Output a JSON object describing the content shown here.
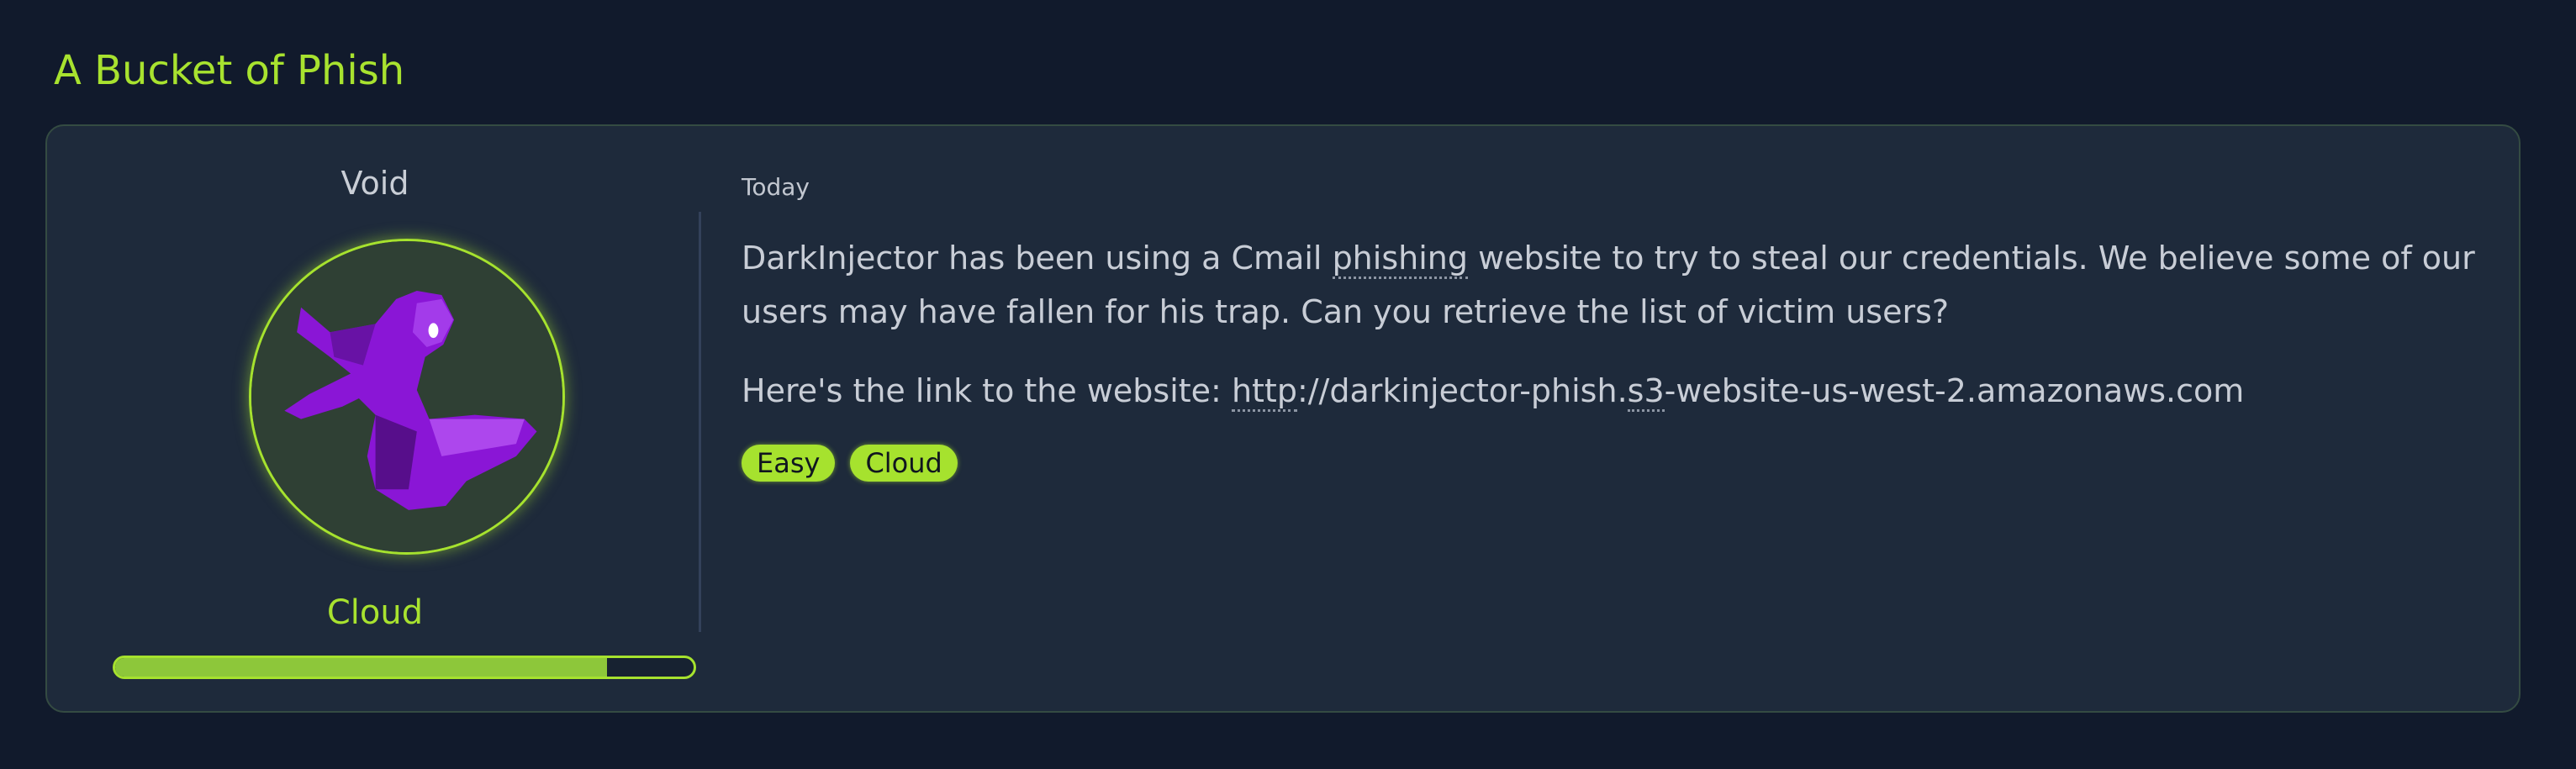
{
  "page": {
    "title": "A Bucket of Phish"
  },
  "profile": {
    "name": "Void",
    "category": "Cloud",
    "progress": 0.85
  },
  "post": {
    "date": "Today",
    "desc_part1": "DarkInjector has been using a Cmail ",
    "desc_abbr": "phishing",
    "desc_part2": " website to try to steal our credentials. We believe some of our users may have fallen for his trap. Can you retrieve the list of victim users?",
    "link_intro": "Here's the link to the website: ",
    "link_abbr1": "http",
    "link_mid": "://darkinjector-phish.",
    "link_abbr2": "s3",
    "link_end": "-website-us-west-2.amazonaws.com",
    "tags": [
      "Easy",
      "Cloud"
    ]
  },
  "colors": {
    "accent": "#a6e22e",
    "avatar_figure": "#8a16d6"
  }
}
